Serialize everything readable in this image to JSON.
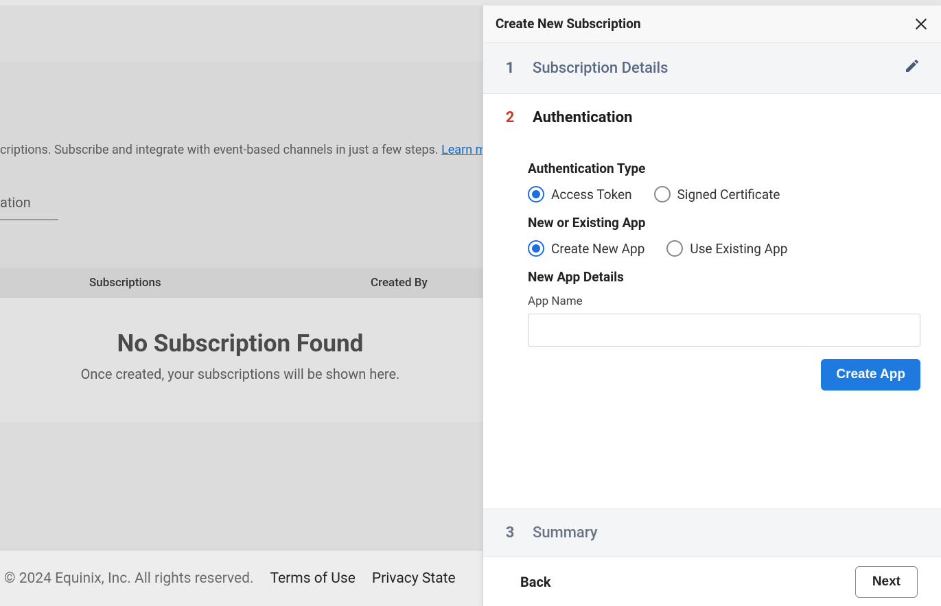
{
  "panel": {
    "title": "Create New Subscription",
    "steps": {
      "s1": {
        "num": "1",
        "label": "Subscription Details"
      },
      "s2": {
        "num": "2",
        "label": "Authentication"
      },
      "s3": {
        "num": "3",
        "label": "Summary"
      }
    },
    "auth": {
      "type_heading": "Authentication Type",
      "type_options": {
        "access_token": "Access Token",
        "signed_cert": "Signed Certificate"
      },
      "app_mode_heading": "New or Existing App",
      "app_mode_options": {
        "create_new": "Create New App",
        "use_existing": "Use Existing App"
      },
      "new_app_heading": "New App Details",
      "app_name_label": "App Name",
      "app_name_value": "",
      "create_app_btn": "Create App"
    },
    "footer": {
      "back": "Back",
      "next": "Next"
    }
  },
  "bg": {
    "description_prefix": "criptions. Subscribe and integrate with event-based channels in just a few steps. ",
    "learn_more": "Learn more",
    "tab_partial": "ation",
    "table": {
      "col_subscriptions": "Subscriptions",
      "col_created_by": "Created By"
    },
    "empty_title": "No Subscription Found",
    "empty_sub": "Once created, your subscriptions will be shown here."
  },
  "footer": {
    "copyright": "© 2024 Equinix, Inc. All rights reserved.",
    "terms": "Terms of Use",
    "privacy": "Privacy State"
  }
}
